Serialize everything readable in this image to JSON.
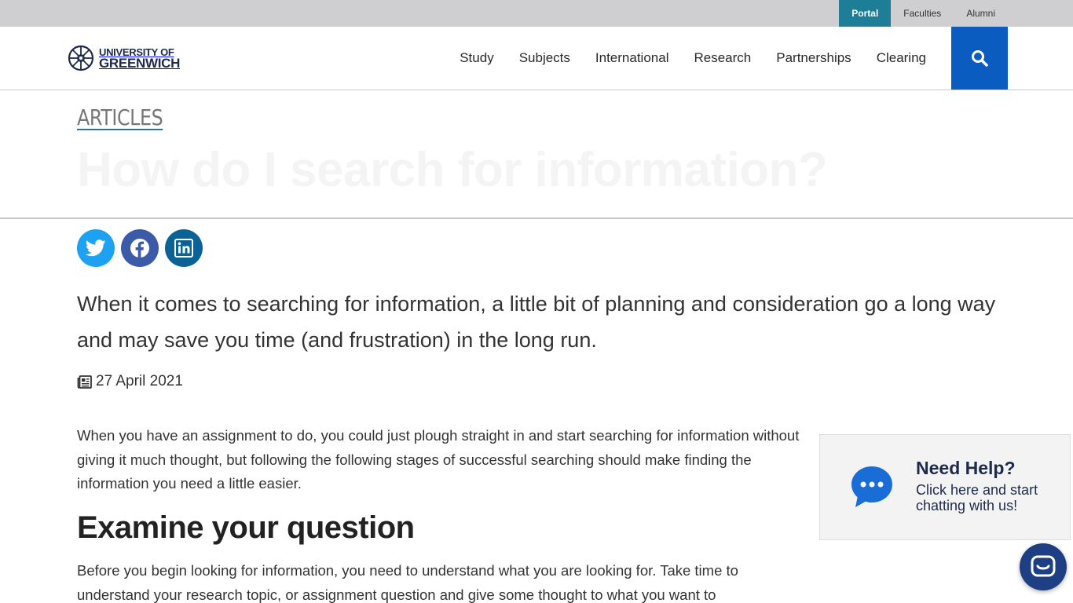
{
  "topbar": {
    "links": [
      {
        "label": "Portal",
        "active": true
      },
      {
        "label": "Faculties"
      },
      {
        "label": "Alumni"
      }
    ]
  },
  "header": {
    "logo_line1": "UNIVERSITY OF",
    "logo_line2": "GREENWICH",
    "nav": [
      "Study",
      "Subjects",
      "International",
      "Research",
      "Partnerships",
      "Clearing"
    ],
    "search_icon": "search-icon"
  },
  "hero": {
    "section_label": "ARTICLES",
    "title": "How do I search for information?"
  },
  "social": [
    {
      "name": "twitter",
      "icon": "twitter-icon",
      "color": "#1da1f2"
    },
    {
      "name": "facebook",
      "icon": "facebook-icon",
      "color": "#3b5ba9"
    },
    {
      "name": "linkedin",
      "icon": "linkedin-icon",
      "color": "#0b6294"
    }
  ],
  "article": {
    "lead": "When it comes to searching for information, a little bit of planning and consideration go a long way and may save you time (and frustration) in the long run.",
    "date": "27 April 2021",
    "paragraph1": "When you have an assignment to do, you could just plough straight in and start searching for information without giving it much thought, but following the following stages of successful searching should make finding the information you need a little easier.",
    "heading1": "Examine your question",
    "paragraph2": "Before you begin looking for information, you need to understand what you are looking for. Take time to understand your research topic, or assignment question and give some thought to what you want to"
  },
  "help_widget": {
    "title": "Need Help?",
    "subtitle": "Click here and start chatting with us!"
  },
  "colors": {
    "portal": "#1e7e98",
    "search": "#0a5cc0",
    "brand_navy": "#1d2a4a",
    "chat_fab": "#1e3f84"
  }
}
